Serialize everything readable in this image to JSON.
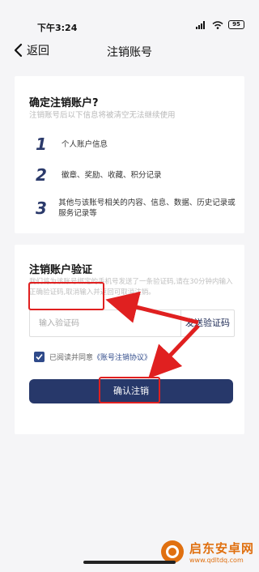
{
  "status_bar": {
    "time": "下午3:24",
    "battery": "95"
  },
  "header": {
    "back_label": "返回",
    "title": "注销账号"
  },
  "confirm_section": {
    "title": "确定注销账户?",
    "subtitle": "注销账号后以下信息将被清空无法继续使用",
    "items": [
      {
        "num": "1",
        "text": "个人账户信息"
      },
      {
        "num": "2",
        "text": "徽章、奖励、收藏、积分记录"
      },
      {
        "num": "3",
        "text": "其他与该账号相关的内容、信息、数据、历史记录或服务记录等"
      }
    ]
  },
  "verify_section": {
    "title": "注销账户验证",
    "description": "我们将为该账号绑定的手机号发送了一条验证码,请在30分钟内输入正确验证码,取消输入并返回可取消注销。",
    "code_placeholder": "输入验证码",
    "send_code_label": "发送验证码",
    "agree_prefix": "已阅读并同意",
    "agree_link": "《账号注销协议》",
    "agree_checked": true,
    "confirm_label": "确认注销"
  },
  "watermark": {
    "name": "启东安卓网",
    "url": "www.qdltdq.com"
  },
  "colors": {
    "accent": "#27386a",
    "highlight": "#e02020",
    "watermark": "#e07010"
  }
}
